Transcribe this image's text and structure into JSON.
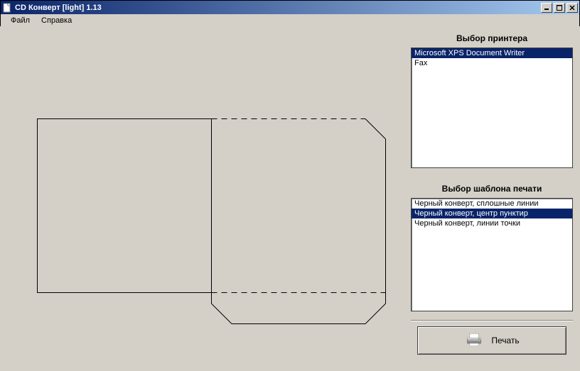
{
  "window": {
    "title": "CD Конверт [light] 1.13"
  },
  "menu": {
    "file": "Файл",
    "help": "Справка"
  },
  "printer_section": {
    "label": "Выбор принтера",
    "items": [
      "Microsoft XPS Document Writer",
      "Fax"
    ],
    "selected_index": 0
  },
  "template_section": {
    "label": "Выбор шаблона печати",
    "items": [
      "Черный конверт, сплошные линии",
      "Черный конверт, центр пунктир",
      "Черный конверт, линии точки"
    ],
    "selected_index": 1
  },
  "print_button": {
    "label": "Печать"
  }
}
